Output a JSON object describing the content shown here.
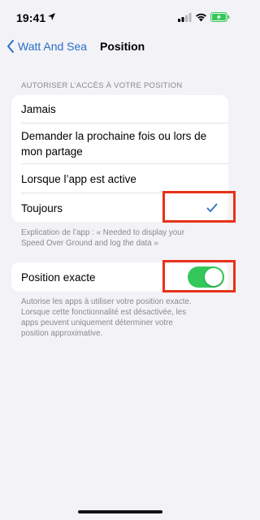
{
  "status_bar": {
    "time": "19:41",
    "icons": [
      "location-arrow-icon",
      "cellular-signal-icon",
      "wifi-icon",
      "battery-charging-icon"
    ],
    "battery_color": "#34c759"
  },
  "nav": {
    "back_label": "Watt And Sea",
    "title": "Position"
  },
  "access_section": {
    "header": "AUTORISER L’ACCÈS À VOTRE POSITION",
    "options": [
      {
        "line1": "Jamais",
        "line2": ""
      },
      {
        "line1": "Demander la prochaine fois ou lors de",
        "line2": "mon partage"
      },
      {
        "line1": "Lorsque l’app est active",
        "line2": ""
      },
      {
        "line1": "Toujours",
        "line2": ""
      }
    ],
    "selected": "Toujours",
    "footer_line1": "Explication de l’app : « Needed to display your",
    "footer_line2": "Speed Over Ground and log the data »"
  },
  "precise_section": {
    "label": "Position exacte",
    "enabled": true,
    "footer_lines": [
      "Autorise les apps à utiliser votre position exacte.",
      "Lorsque cette fonctionnalité est désactivée, les",
      "apps peuvent uniquement déterminer votre",
      "position approximative."
    ]
  },
  "colors": {
    "accent": "#2b6fc6",
    "toggle_on": "#34c759",
    "highlight": "#e8311a",
    "background": "#f2f2f7"
  }
}
